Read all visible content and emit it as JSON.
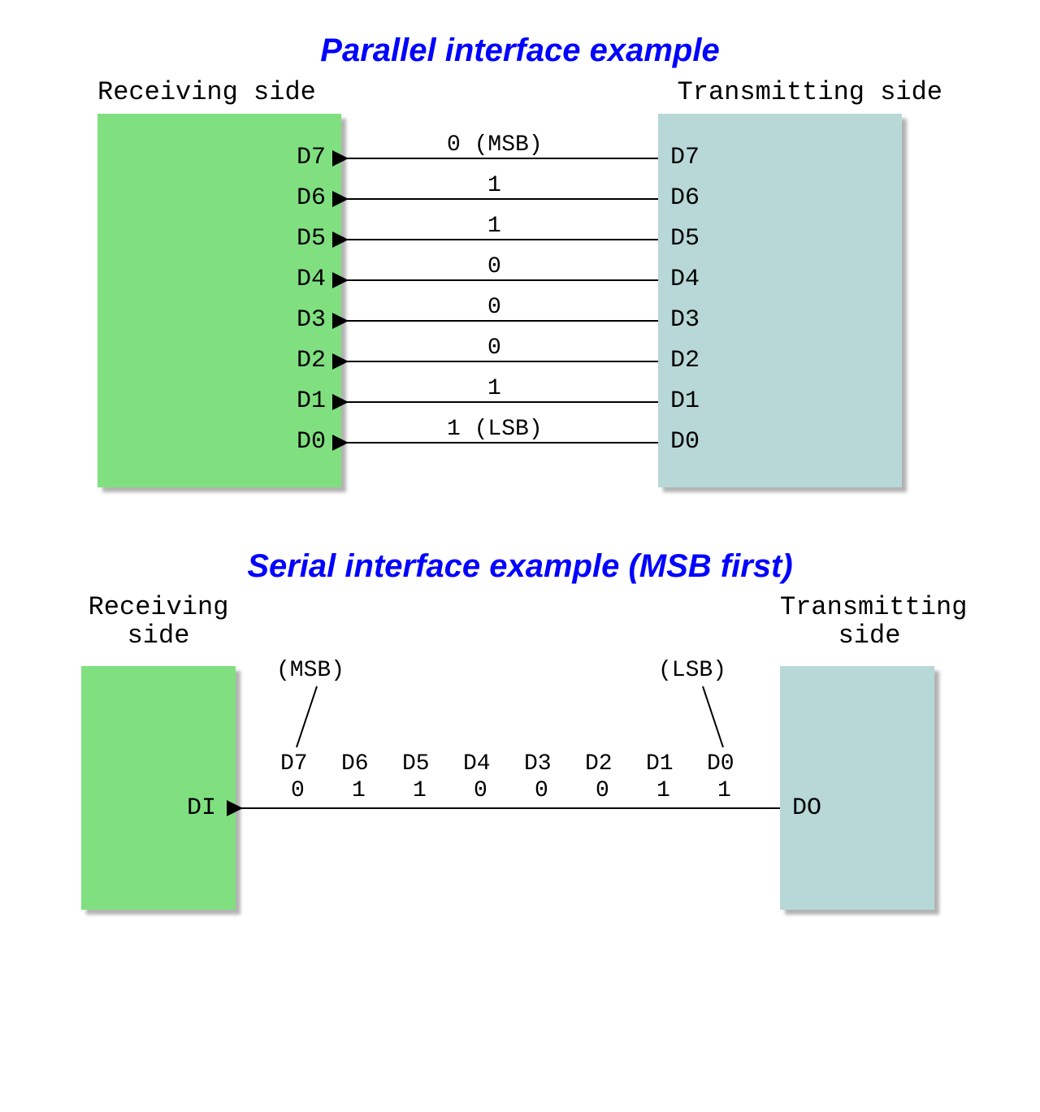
{
  "parallel": {
    "title": "Parallel interface example",
    "rx_label": "Receiving side",
    "tx_label": "Transmitting side",
    "pins": [
      "D7",
      "D6",
      "D5",
      "D4",
      "D3",
      "D2",
      "D1",
      "D0"
    ],
    "signals": [
      "0 (MSB)",
      "1",
      "1",
      "0",
      "0",
      "0",
      "1",
      "1 (LSB)"
    ]
  },
  "serial": {
    "title": "Serial interface example (MSB first)",
    "rx_label": "Receiving side",
    "tx_label": "Transmitting side",
    "msb_note": "(MSB)",
    "lsb_note": "(LSB)",
    "rx_pin": "DI",
    "tx_pin": "DO",
    "bit_labels": [
      "D7",
      "D6",
      "D5",
      "D4",
      "D3",
      "D2",
      "D1",
      "D0"
    ],
    "bit_values": [
      "0",
      "1",
      "1",
      "0",
      "0",
      "0",
      "1",
      "1"
    ]
  },
  "colors": {
    "title": "#0000ff",
    "rx_box": "#80e080",
    "tx_box": "#b8d8d8"
  }
}
